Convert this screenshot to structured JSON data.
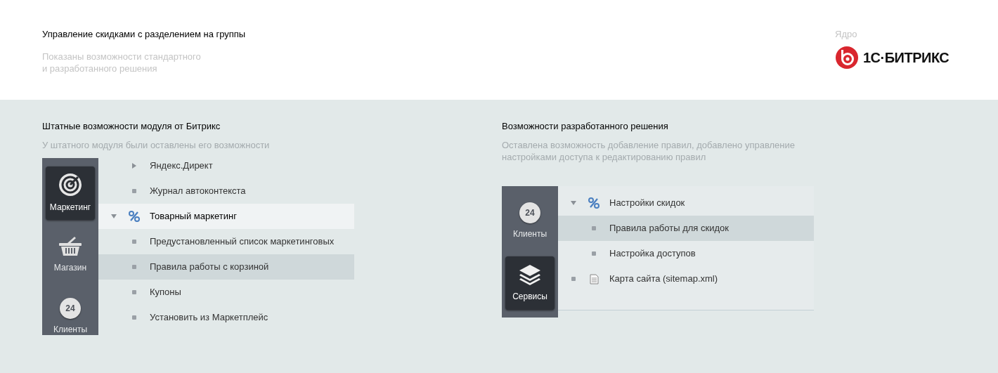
{
  "header": {
    "title": "Управление скидками с разделением на группы",
    "subtitle_lines": [
      "Показаны возможности стандартного",
      "и разработанного решения"
    ],
    "core_label": "Ядро",
    "logo_text": "1С·БИТРИКС"
  },
  "panels": [
    {
      "title": "Штатные возможности модуля от Битрикс",
      "description_lines": [
        "У штатного модуля были оставлены его возможности"
      ],
      "sidebar": [
        {
          "label": "Маркетинг",
          "kind": "target",
          "selected": true
        },
        {
          "label": "Магазин",
          "kind": "basket",
          "selected": false
        },
        {
          "label": "Клиенты",
          "kind": "cloud",
          "badge": "24",
          "selected": false
        }
      ],
      "menu": [
        {
          "label": "Яндекс.Директ",
          "expanded": false,
          "selected": false,
          "active": false
        },
        {
          "label": "Журнал автоконтекста",
          "selected": false,
          "active": false
        },
        {
          "label": "Товарный маркетинг",
          "kind": "percent",
          "expanded": true,
          "selected": false,
          "active": true,
          "children": [
            {
              "label": "Предустановленный список маркетинговых",
              "selected": false,
              "active": false
            },
            {
              "label": "Правила работы с корзиной",
              "selected": true,
              "active": false
            },
            {
              "label": "Купоны",
              "selected": false,
              "active": false
            },
            {
              "label": "Установить из Маркетплейс",
              "selected": false,
              "active": false
            }
          ]
        }
      ]
    },
    {
      "title": "Возможности разработанного решения",
      "description_lines": [
        "Оставлена возможность добавление правил, добавлено управление",
        "настройками доступа к редактированию правил"
      ],
      "sidebar": [
        {
          "label": "Клиенты",
          "kind": "cloud",
          "badge": "24",
          "selected": false
        },
        {
          "label": "Сервисы",
          "kind": "layers",
          "selected": true
        }
      ],
      "menu": [
        {
          "label": "Настройки скидок",
          "kind": "percent",
          "expanded": true,
          "selected": false,
          "active": false,
          "children": [
            {
              "label": "Правила работы для скидок",
              "selected": true,
              "active": false
            },
            {
              "label": "Настройка доступов",
              "selected": false,
              "active": false
            }
          ]
        },
        {
          "label": "Карта сайта (sitemap.xml)",
          "kind": "document",
          "selected": false,
          "active": false
        }
      ]
    }
  ]
}
